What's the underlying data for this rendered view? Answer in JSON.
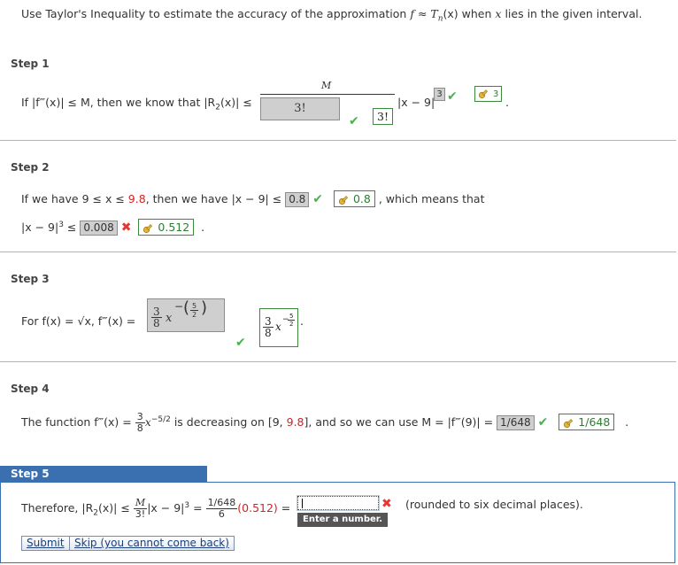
{
  "question": {
    "text_before": "Use Taylor's Inequality to estimate the accuracy of the approximation ",
    "text_f": "f",
    "approx_sym": " ≈ ",
    "text_T": "T",
    "text_n": "n",
    "text_x": "(x)",
    "text_mid": " when ",
    "text_x2": "x",
    "text_after": " lies in the given interval."
  },
  "step1": {
    "label": "Step 1",
    "text_before": "If |f‴(x)| ≤ M, then we know that |R",
    "sub": "2",
    "text_mid": "(x)| ≤",
    "frac_num": "M",
    "input_value": "3!",
    "answer_value": "3!",
    "abs_text": "|x − 9|",
    "exp_input": "3",
    "exp_answer": "3",
    "period": "."
  },
  "step2": {
    "label": "Step 2",
    "line1_before": "If we have 9 ≤ x ≤ ",
    "line1_red": "9.8",
    "line1_mid": ", then we have |x − 9| ≤ ",
    "input1": "0.8",
    "answer1": "0.8",
    "line1_after": ", which means that",
    "line2_before": "|x − 9|",
    "line2_exp": "3",
    "line2_le": " ≤ ",
    "input2": "0.008",
    "answer2": "0.512",
    "period": "."
  },
  "step3": {
    "label": "Step 3",
    "text_before": "For f(x) = √x, f‴(x) =",
    "input_num": "3",
    "input_den": "8",
    "input_var": "x",
    "input_exp_num": "5",
    "input_exp_den": "2",
    "answer_num": "3",
    "answer_den": "8",
    "answer_var": "x",
    "answer_exp_num": "5",
    "answer_exp_den": "2",
    "period": "."
  },
  "step4": {
    "label": "Step 4",
    "text_before": "The function f‴(x) =",
    "frac_num": "3",
    "frac_den": "8",
    "text_var": "x",
    "text_exp": "−5/2",
    "text_mid": " is decreasing on [9, ",
    "text_red": "9.8",
    "text_mid2": "], and so we can use M = |f‴(9)| = ",
    "input_value": "1/648",
    "answer_value": "1/648",
    "period": "."
  },
  "step5": {
    "label": "Step 5",
    "text_before": "Therefore, |R",
    "sub": "2",
    "text_mid": "(x)| ≤",
    "frac1_num": "M",
    "frac1_den": "3!",
    "abs_text": "|x − 9|",
    "abs_exp": "3",
    "eq": " = ",
    "frac2_num": "1/648",
    "frac2_den": "6",
    "red_val": "(0.512)",
    "eq2": " =",
    "input_value": "",
    "tooltip": "Enter a number.",
    "suffix": "(rounded to six decimal places)."
  },
  "buttons": {
    "submit": "Submit",
    "skip": "Skip (you cannot come back)"
  }
}
